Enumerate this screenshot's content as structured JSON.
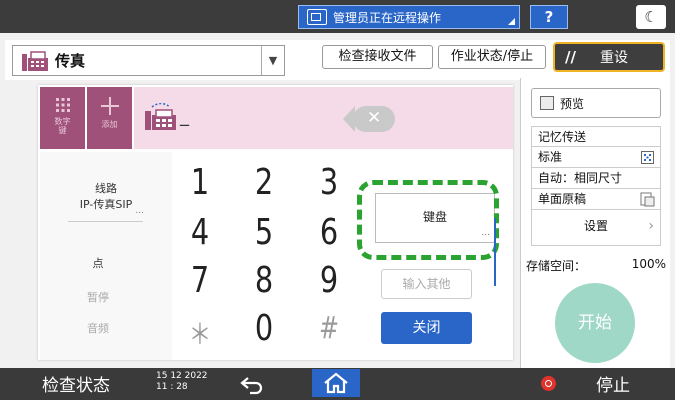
{
  "topbar": {
    "remote_text": "管理员正在远程操作",
    "help_label": "?",
    "moon_label": "☾"
  },
  "header": {
    "mode_label": "传真",
    "check_received_label": "检查接收文件",
    "job_status_label": "作业状态/停止",
    "reset_label": "重设",
    "reset_icon": "//"
  },
  "controls": {
    "numpad_label": "数字键",
    "add_label": "添加"
  },
  "destination": {
    "cursor": "_"
  },
  "left_col": {
    "line_label": "线路",
    "line_value": "IP-传真SIP",
    "ellipsis": "...",
    "dot_label": "点",
    "pause_label": "暂停",
    "tone_label": "音频"
  },
  "keypad": {
    "keys": [
      "1",
      "2",
      "3",
      "4",
      "5",
      "6",
      "7",
      "8",
      "9",
      "＊",
      "0",
      "#"
    ]
  },
  "actions": {
    "keyboard_label": "键盘",
    "keyboard_ellipsis": "...",
    "input_other_label": "输入其他",
    "close_label": "关闭"
  },
  "settings": {
    "preview_label": "预览",
    "memory_tx": "记忆传送",
    "quality": "标准",
    "size": "自动：相同尺寸",
    "sides": "单面原稿",
    "settings_label": "设置",
    "storage_label": "存储空间：",
    "storage_value": "100%",
    "start_label": "开始"
  },
  "bottombar": {
    "status_check": "检查状态",
    "date": "15 12 2022",
    "time": "11 : 28",
    "stop_label": "停止"
  },
  "colors": {
    "accent_blue": "#2a66c8",
    "fax_magenta": "#a0517a",
    "dest_pink": "#f5dbe8",
    "highlight_green": "#2aa330",
    "reset_border": "#f0b323",
    "start_mint": "#9fd8c7"
  }
}
